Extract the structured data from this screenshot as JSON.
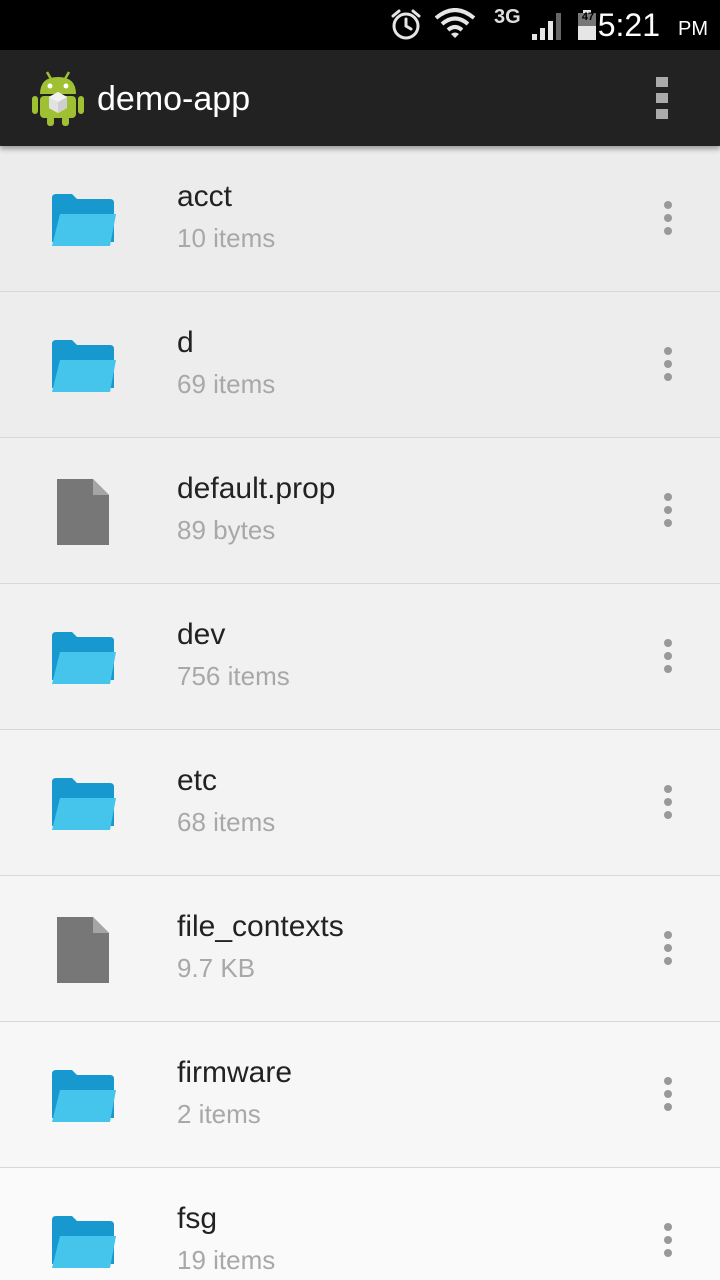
{
  "status_bar": {
    "time": "5:21",
    "ampm": "PM",
    "network_type": "3G",
    "battery_level": "47",
    "icons": [
      "alarm-icon",
      "wifi-icon",
      "signal-icon",
      "battery-icon"
    ]
  },
  "action_bar": {
    "title": "demo-app",
    "app_icon": "android-robot-icon",
    "menu_icon": "overflow-menu-icon"
  },
  "colors": {
    "folder": "#45c4ec",
    "folder_back": "#1798cf",
    "file": "#777777",
    "action_bar": "#222222",
    "status_bar": "#000000",
    "android_green": "#9fc032"
  },
  "files": [
    {
      "name": "acct",
      "meta": "10 items",
      "type": "folder",
      "bg": "#ececec"
    },
    {
      "name": "d",
      "meta": "69 items",
      "type": "folder",
      "bg": "#ededed"
    },
    {
      "name": "default.prop",
      "meta": "89 bytes",
      "type": "file",
      "bg": "#efefef"
    },
    {
      "name": "dev",
      "meta": "756 items",
      "type": "folder",
      "bg": "#f1f1f1"
    },
    {
      "name": "etc",
      "meta": "68 items",
      "type": "folder",
      "bg": "#f3f3f3"
    },
    {
      "name": "file_contexts",
      "meta": "9.7 KB",
      "type": "file",
      "bg": "#f5f5f5"
    },
    {
      "name": "firmware",
      "meta": "2 items",
      "type": "folder",
      "bg": "#f7f7f7"
    },
    {
      "name": "fsg",
      "meta": "19 items",
      "type": "folder",
      "bg": "#fafafa"
    }
  ]
}
